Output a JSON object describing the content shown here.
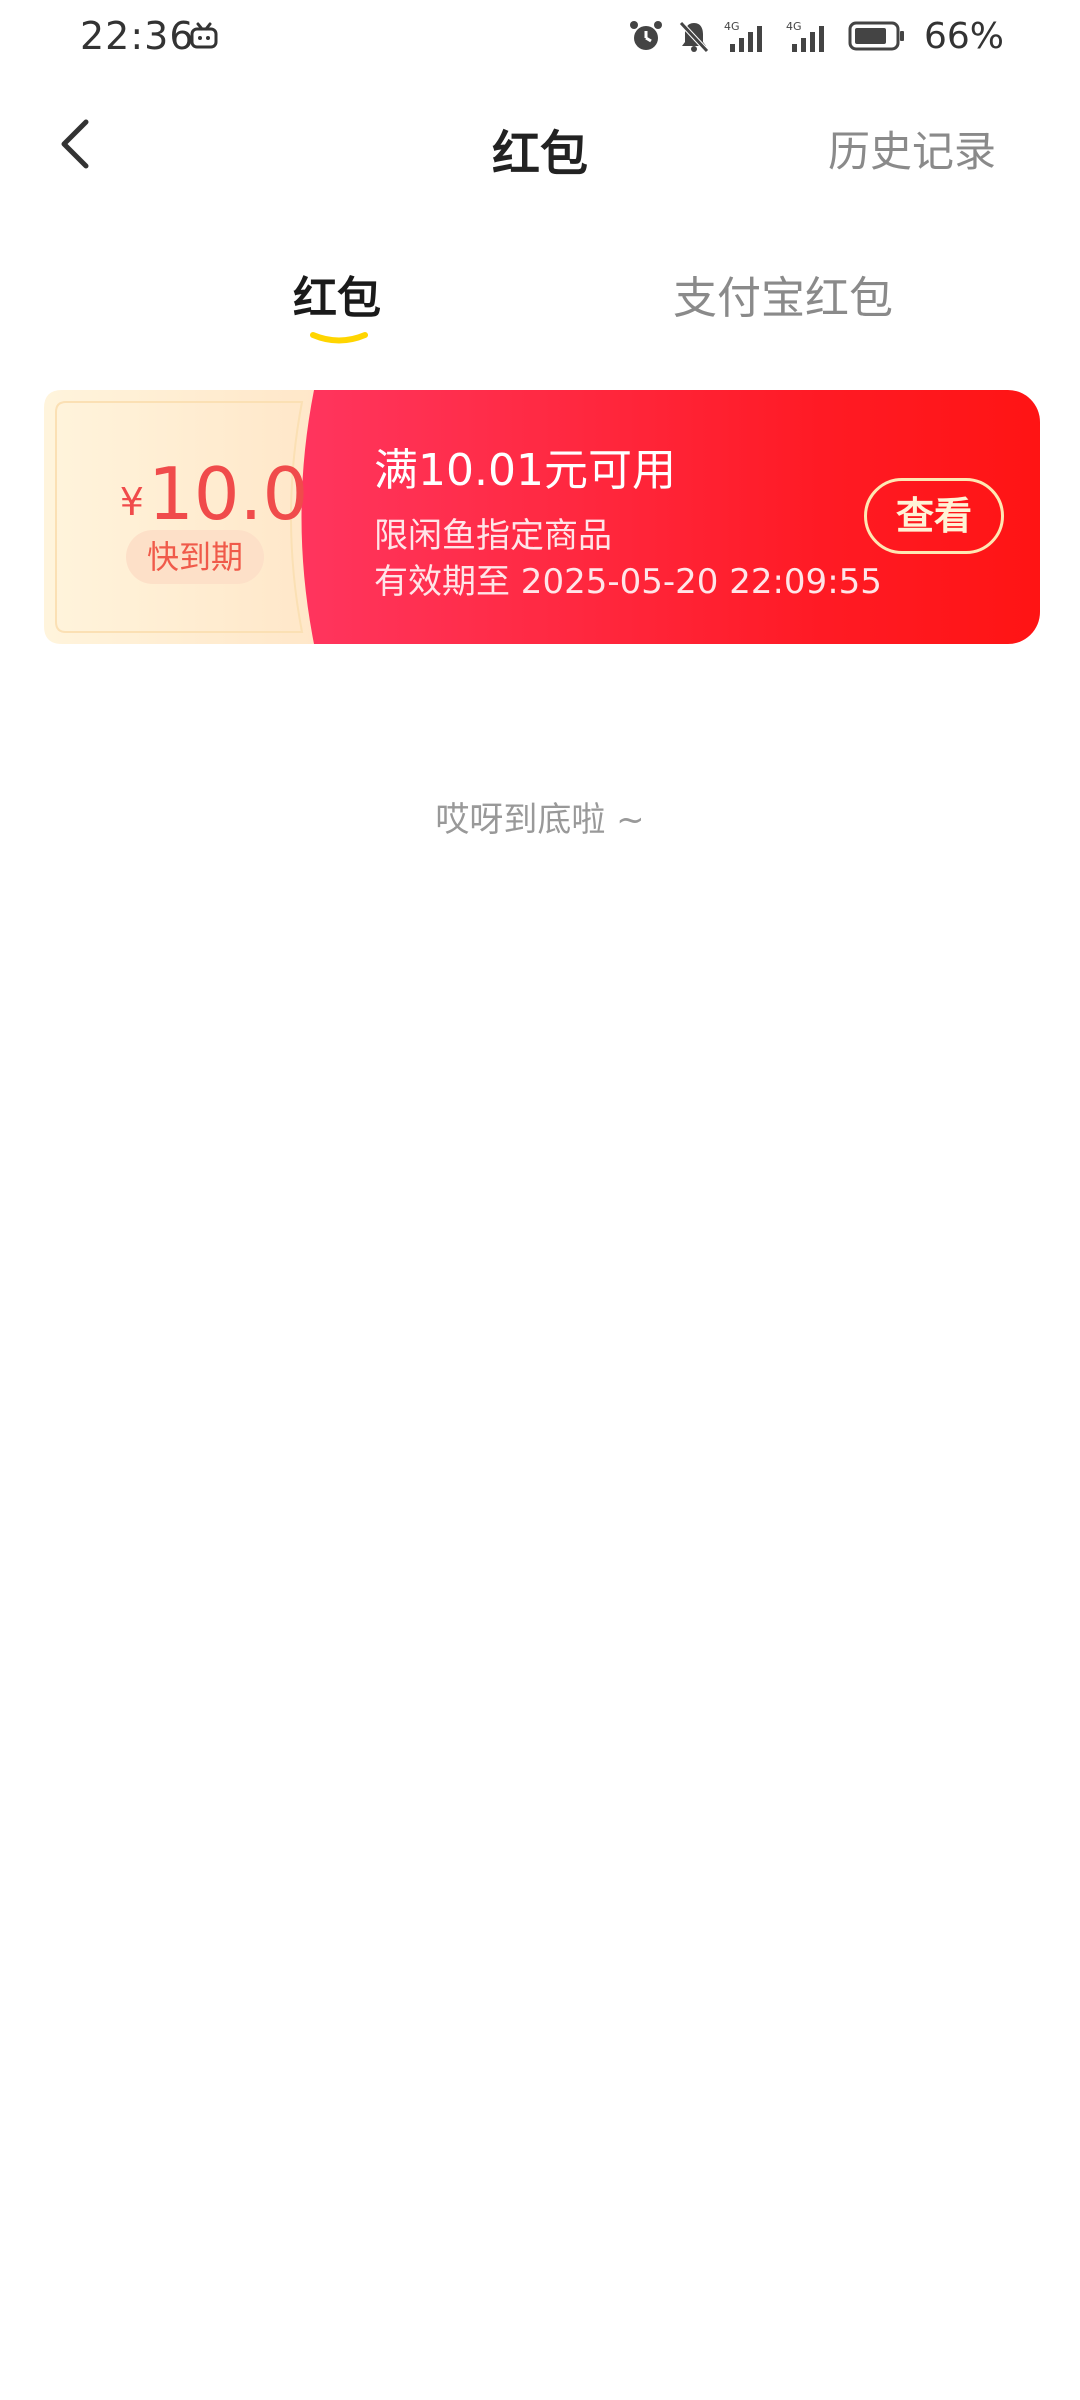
{
  "status_bar": {
    "time": "22:36",
    "battery": "66%",
    "network1": "4G",
    "network2": "4G",
    "icons": [
      "tv-app-icon",
      "alarm-icon",
      "mute-bell-icon",
      "signal-icon",
      "signal-icon",
      "battery-icon"
    ]
  },
  "nav": {
    "title": "红包",
    "history_label": "历史记录",
    "back_icon": "chevron-left-icon"
  },
  "tabs": [
    {
      "label": "红包",
      "active": true
    },
    {
      "label": "支付宝红包",
      "active": false
    }
  ],
  "coupon": {
    "currency": "¥",
    "amount": "10.0",
    "badge": "快到期",
    "condition": "满10.01元可用",
    "scope": "限闲鱼指定商品",
    "expiry": "有效期至 2025-05-20 22:09:55",
    "button_label": "查看"
  },
  "end_hint": "哎呀到底啦 ~",
  "colors": {
    "accent_red": "#ff1a24",
    "accent_pink": "#ff3a6c",
    "tab_underline": "#ffd500",
    "coupon_amount": "#f04b4b"
  }
}
